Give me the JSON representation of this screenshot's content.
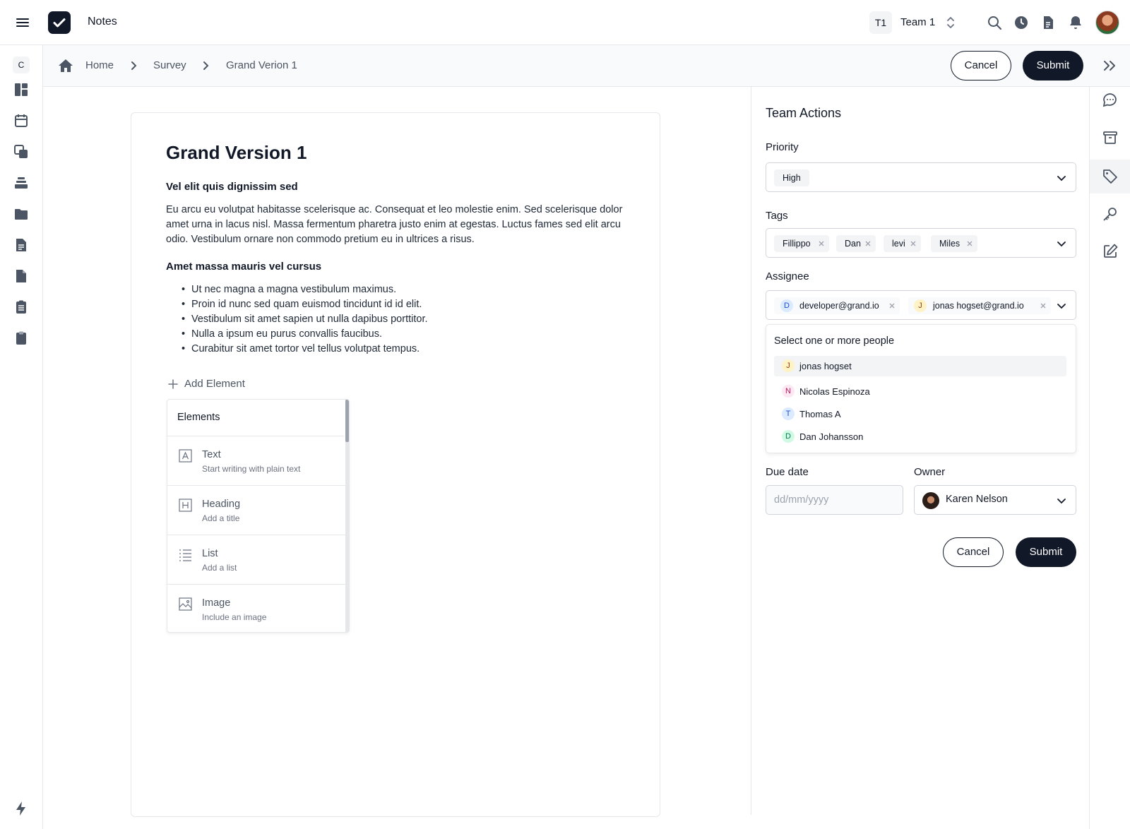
{
  "app": {
    "name": "Notes"
  },
  "team": {
    "badge": "T1",
    "name": "Team 1"
  },
  "topbar_icons": [
    "search-icon",
    "clock-icon",
    "document-icon",
    "bell-icon"
  ],
  "leftrail": {
    "badge": "C",
    "icons": [
      "dashboard-icon",
      "calendar-icon",
      "copy-icon",
      "stack-icon",
      "folder-icon",
      "document-lines-icon",
      "file-icon",
      "clipboard-list-icon",
      "clipboard-icon",
      "bolt-icon"
    ]
  },
  "breadcrumb": {
    "items": [
      "Home",
      "Survey",
      "Grand Verion 1"
    ]
  },
  "header_actions": {
    "cancel": "Cancel",
    "submit": "Submit"
  },
  "document": {
    "title": "Grand Version 1",
    "section1_heading": "Vel elit quis dignissim sed",
    "section1_paragraph": "Eu arcu eu volutpat habitasse scelerisque ac. Consequat et leo molestie enim. Sed scelerisque dolor amet urna in lacus nisl. Massa fermentum pharetra justo enim at egestas. Luctus fames sed elit arcu odio. Vestibulum ornare non commodo pretium eu in ultrices a risus.",
    "section2_heading": "Amet massa mauris vel cursus",
    "bullets": [
      "Ut nec magna a magna vestibulum maximus.",
      "Proin id nunc sed quam euismod tincidunt id id elit.",
      "Vestibulum sit amet sapien ut nulla dapibus porttitor.",
      "Nulla a ipsum eu purus convallis faucibus.",
      "Curabitur sit amet tortor vel tellus volutpat tempus."
    ],
    "add_element_label": "Add Element"
  },
  "elements_panel": {
    "title": "Elements",
    "items": [
      {
        "title": "Text",
        "subtitle": "Start writing with plain text",
        "icon": "text-box-icon"
      },
      {
        "title": "Heading",
        "subtitle": "Add a title",
        "icon": "heading-box-icon"
      },
      {
        "title": "List",
        "subtitle": "Add a list",
        "icon": "list-icon"
      },
      {
        "title": "Image",
        "subtitle": "Include an image",
        "icon": "image-icon"
      }
    ]
  },
  "team_actions": {
    "title": "Team Actions",
    "priority": {
      "label": "Priority",
      "value": "High"
    },
    "tags": {
      "label": "Tags",
      "values": [
        "Fillippo",
        "Dan",
        "levi",
        "Miles"
      ]
    },
    "assignee": {
      "label": "Assignee",
      "selected": [
        {
          "initial": "D",
          "email": "developer@grand.io"
        },
        {
          "initial": "J",
          "email": "jonas hogset@grand.io"
        }
      ],
      "dropdown": {
        "header": "Select one or more people",
        "options": [
          {
            "initial": "J",
            "name": "jonas hogset"
          },
          {
            "initial": "N",
            "name": "Nicolas Espinoza"
          },
          {
            "initial": "T",
            "name": "Thomas A"
          },
          {
            "initial": "D",
            "name": "Dan Johansson"
          }
        ]
      }
    },
    "due_date": {
      "label": "Due date",
      "placeholder": "dd/mm/yyyy"
    },
    "owner": {
      "label": "Owner",
      "name": "Karen Nelson"
    },
    "cancel": "Cancel",
    "submit": "Submit"
  },
  "right_rail_icons": [
    "chat-icon",
    "archive-icon",
    "tag-icon",
    "key-icon",
    "edit-icon"
  ]
}
